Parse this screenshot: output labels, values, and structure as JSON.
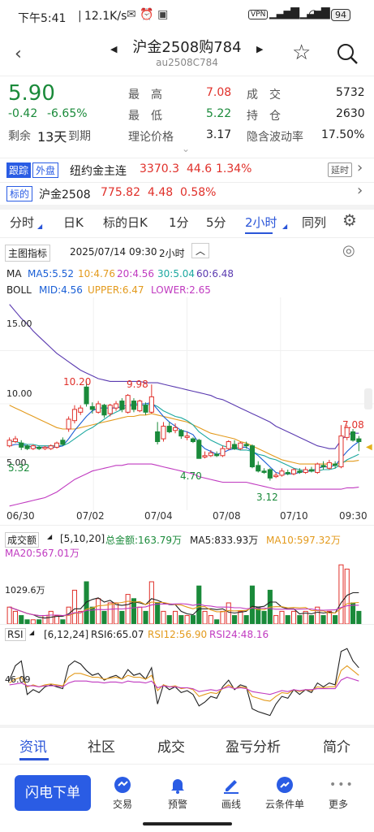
{
  "status_bar": {
    "time": "下午5:41",
    "speed": "12.1K/s",
    "battery": "94"
  },
  "header": {
    "title": "沪金2508购784",
    "code": "au2508C784"
  },
  "quote": {
    "price": "5.90",
    "change": "-0.42",
    "change_pct": "-6.65%",
    "remain_label": "剩余",
    "remain_days": "13天",
    "expire_label": "到期",
    "high_label": "最　高",
    "high": "7.08",
    "low_label": "最　低",
    "low": "5.22",
    "theory_label": "理论价格",
    "theory": "3.17",
    "volume_label": "成　交",
    "volume": "5732",
    "oi_label": "持　仓",
    "oi": "2630",
    "iv_label": "隐含波动率",
    "iv": "17.50%"
  },
  "track": {
    "tag1": "跟踪",
    "tag2": "外盘",
    "name": "纽约金主连",
    "price": "3370.3",
    "chg": "44.6",
    "pct": "1.34%",
    "delay": "延时"
  },
  "underlying": {
    "tag": "标的",
    "name": "沪金2508",
    "price": "775.82",
    "chg": "4.48",
    "pct": "0.58%"
  },
  "period_tabs": [
    "分时",
    "日K",
    "标的日K",
    "1分",
    "5分",
    "2小时",
    "同列"
  ],
  "chart_header": {
    "indicator": "主图指标",
    "datetime": "2025/07/14 09:30",
    "period": "2小时"
  },
  "ma_legend": {
    "ma": "MA",
    "ma5": "MA5:5.52",
    "ma10": "10:4.76",
    "ma20": "20:4.56",
    "ma30": "30:5.04",
    "ma60": "60:6.48"
  },
  "boll_legend": {
    "boll": "BOLL",
    "mid": "MID:4.56",
    "upper": "UPPER:6.47",
    "lower": "LOWER:2.65"
  },
  "price_axis": {
    "p15": "15.00",
    "p10": "10.00",
    "p5": "5.00"
  },
  "price_marks": {
    "m1": "10.20",
    "m2": "9.98",
    "m3": "4.70",
    "m4": "3.12",
    "m5": "7.08",
    "m6": "5.32"
  },
  "date_axis": [
    "06/30",
    "07/02",
    "07/04",
    "07/08",
    "07/10",
    "09:30"
  ],
  "vol_legend": {
    "name": "成交额",
    "params": "[5,10,20]",
    "total": "总金额:163.79万",
    "ma5": "MA5:833.93万",
    "ma10": "MA10:597.32万",
    "ma20": "MA20:567.01万",
    "axis": "1029.6万"
  },
  "rsi_legend": {
    "name": "RSI",
    "params": "[6,12,24]",
    "rsi6": "RSI6:65.07",
    "rsi12": "RSI12:56.90",
    "rsi24": "RSI24:48.16",
    "axis": "46.09"
  },
  "bottom_tabs": [
    "资讯",
    "社区",
    "成交",
    "盈亏分析",
    "简介"
  ],
  "bottom_nav": {
    "flash": "闪电下单",
    "items": [
      "交易",
      "预警",
      "画线",
      "云条件单",
      "更多"
    ]
  },
  "colors": {
    "up": "#e0302a",
    "down": "#1a8a3a",
    "accent": "#2a55d8"
  },
  "chart_data": {
    "type": "candlestick",
    "candles": [
      {
        "o": 5.6,
        "c": 6.0,
        "h": 6.2,
        "l": 5.5
      },
      {
        "o": 5.9,
        "c": 6.1,
        "h": 6.3,
        "l": 5.8
      },
      {
        "o": 5.8,
        "c": 5.5,
        "h": 6.0,
        "l": 5.3
      },
      {
        "o": 5.6,
        "c": 5.4,
        "h": 5.7,
        "l": 5.3
      },
      {
        "o": 5.4,
        "c": 5.6,
        "h": 5.7,
        "l": 5.3
      },
      {
        "o": 5.5,
        "c": 5.4,
        "h": 5.6,
        "l": 5.3
      },
      {
        "o": 5.4,
        "c": 5.5,
        "h": 5.6,
        "l": 5.3
      },
      {
        "o": 5.4,
        "c": 5.6,
        "h": 5.7,
        "l": 5.3
      },
      {
        "o": 5.5,
        "c": 5.8,
        "h": 5.9,
        "l": 5.4
      },
      {
        "o": 6.0,
        "c": 5.7,
        "h": 6.2,
        "l": 5.6
      },
      {
        "o": 6.8,
        "c": 7.5,
        "h": 7.7,
        "l": 6.6
      },
      {
        "o": 7.4,
        "c": 8.2,
        "h": 8.5,
        "l": 7.2
      },
      {
        "o": 8.0,
        "c": 8.3,
        "h": 8.5,
        "l": 7.8
      },
      {
        "o": 9.8,
        "c": 8.6,
        "h": 10.2,
        "l": 8.4
      },
      {
        "o": 8.4,
        "c": 8.2,
        "h": 8.7,
        "l": 7.9
      },
      {
        "o": 8.0,
        "c": 8.6,
        "h": 8.8,
        "l": 7.9
      },
      {
        "o": 8.5,
        "c": 7.8,
        "h": 8.6,
        "l": 7.6
      },
      {
        "o": 7.9,
        "c": 8.5,
        "h": 8.6,
        "l": 7.7
      },
      {
        "o": 8.3,
        "c": 8.6,
        "h": 8.8,
        "l": 8.1
      },
      {
        "o": 8.8,
        "c": 8.2,
        "h": 9.0,
        "l": 8.0
      },
      {
        "o": 8.0,
        "c": 9.2,
        "h": 9.3,
        "l": 7.9
      },
      {
        "o": 8.8,
        "c": 8.2,
        "h": 9.0,
        "l": 8.0
      },
      {
        "o": 8.1,
        "c": 8.8,
        "h": 8.9,
        "l": 8.0
      },
      {
        "o": 8.5,
        "c": 8.0,
        "h": 8.7,
        "l": 7.8
      },
      {
        "o": 8.0,
        "c": 9.1,
        "h": 9.98,
        "l": 7.9
      },
      {
        "o": 6.6,
        "c": 5.9,
        "h": 7.3,
        "l": 5.7
      },
      {
        "o": 6.1,
        "c": 7.0,
        "h": 7.3,
        "l": 5.9
      },
      {
        "o": 7.0,
        "c": 6.6,
        "h": 7.3,
        "l": 6.5
      },
      {
        "o": 6.7,
        "c": 6.9,
        "h": 7.2,
        "l": 6.5
      },
      {
        "o": 6.7,
        "c": 6.3,
        "h": 6.8,
        "l": 6.1
      },
      {
        "o": 6.2,
        "c": 6.3,
        "h": 6.6,
        "l": 6.0
      },
      {
        "o": 6.1,
        "c": 5.9,
        "h": 6.2,
        "l": 5.8
      },
      {
        "o": 6.0,
        "c": 4.7,
        "h": 6.1,
        "l": 4.7
      },
      {
        "o": 4.8,
        "c": 4.9,
        "h": 5.2,
        "l": 4.7
      },
      {
        "o": 4.9,
        "c": 5.1,
        "h": 5.3,
        "l": 4.8
      },
      {
        "o": 5.0,
        "c": 4.9,
        "h": 5.2,
        "l": 4.8
      },
      {
        "o": 4.9,
        "c": 5.4,
        "h": 5.6,
        "l": 4.8
      },
      {
        "o": 5.4,
        "c": 5.9,
        "h": 6.0,
        "l": 5.3
      },
      {
        "o": 5.7,
        "c": 5.4,
        "h": 6.0,
        "l": 5.3
      },
      {
        "o": 5.4,
        "c": 5.8,
        "h": 5.9,
        "l": 5.3
      },
      {
        "o": 5.7,
        "c": 5.6,
        "h": 5.9,
        "l": 5.4
      },
      {
        "o": 5.6,
        "c": 4.1,
        "h": 5.7,
        "l": 4.0
      },
      {
        "o": 4.2,
        "c": 3.8,
        "h": 4.5,
        "l": 3.7
      },
      {
        "o": 3.8,
        "c": 3.7,
        "h": 4.0,
        "l": 3.6
      },
      {
        "o": 3.9,
        "c": 3.3,
        "h": 4.0,
        "l": 3.12
      },
      {
        "o": 3.4,
        "c": 3.5,
        "h": 3.7,
        "l": 3.3
      },
      {
        "o": 3.5,
        "c": 3.8,
        "h": 4.0,
        "l": 3.4
      },
      {
        "o": 3.7,
        "c": 3.6,
        "h": 3.9,
        "l": 3.5
      },
      {
        "o": 3.6,
        "c": 3.9,
        "h": 4.0,
        "l": 3.5
      },
      {
        "o": 3.8,
        "c": 3.7,
        "h": 4.0,
        "l": 3.6
      },
      {
        "o": 3.7,
        "c": 3.9,
        "h": 4.1,
        "l": 3.6
      },
      {
        "o": 3.9,
        "c": 3.8,
        "h": 4.1,
        "l": 3.7
      },
      {
        "o": 3.7,
        "c": 4.3,
        "h": 4.4,
        "l": 3.6
      },
      {
        "o": 4.2,
        "c": 4.1,
        "h": 4.5,
        "l": 3.9
      },
      {
        "o": 4.0,
        "c": 4.4,
        "h": 4.6,
        "l": 3.9
      },
      {
        "o": 4.3,
        "c": 4.2,
        "h": 4.5,
        "l": 4.0
      },
      {
        "o": 4.1,
        "c": 6.3,
        "h": 7.08,
        "l": 4.0
      },
      {
        "o": 6.2,
        "c": 6.9,
        "h": 7.08,
        "l": 6.0
      },
      {
        "o": 6.6,
        "c": 6.0,
        "h": 6.8,
        "l": 5.9
      },
      {
        "o": 6.1,
        "c": 5.9,
        "h": 6.3,
        "l": 5.22
      }
    ],
    "ma5": [
      5.6,
      5.7,
      5.7,
      5.6,
      5.5,
      5.5,
      5.5,
      5.5,
      5.5,
      5.6,
      6.1,
      6.7,
      7.2,
      7.7,
      8.1,
      8.3,
      8.3,
      8.3,
      8.3,
      8.4,
      8.5,
      8.6,
      8.6,
      8.6,
      8.7,
      8.2,
      7.7,
      7.3,
      7.0,
      6.7,
      6.6,
      6.4,
      5.8,
      5.4,
      5.2,
      5.0,
      5.1,
      5.3,
      5.4,
      5.5,
      5.5,
      5.2,
      4.9,
      4.5,
      4.1,
      3.7,
      3.6,
      3.6,
      3.6,
      3.7,
      3.8,
      3.8,
      4.0,
      4.1,
      4.1,
      4.2,
      4.7,
      5.2,
      5.6,
      5.9
    ],
    "ma10": [
      5.9,
      5.9,
      5.8,
      5.7,
      5.7,
      5.6,
      5.6,
      5.6,
      5.6,
      5.6,
      5.8,
      6.1,
      6.4,
      6.7,
      6.9,
      7.2,
      7.5,
      7.8,
      8.0,
      8.2,
      8.4,
      8.5,
      8.5,
      8.5,
      8.6,
      8.4,
      8.1,
      7.9,
      7.7,
      7.6,
      7.4,
      7.1,
      6.6,
      6.3,
      6.0,
      5.8,
      5.6,
      5.5,
      5.4,
      5.3,
      5.3,
      5.2,
      5.0,
      4.9,
      4.7,
      4.6,
      4.4,
      4.2,
      4.0,
      3.9,
      3.8,
      3.8,
      3.8,
      3.9,
      3.9,
      4.0,
      4.3,
      4.6,
      4.8,
      5.0
    ],
    "boll_upper": [
      15.7,
      15.2,
      14.7,
      14.3,
      13.8,
      13.4,
      13.0,
      12.6,
      12.2,
      11.9,
      11.6,
      11.3,
      11.0,
      10.8,
      10.6,
      10.4,
      10.3,
      10.2,
      10.2,
      10.2,
      10.2,
      10.2,
      10.2,
      10.1,
      10.1,
      10.1,
      10.0,
      9.9,
      9.8,
      9.7,
      9.6,
      9.5,
      9.4,
      9.3,
      9.2,
      9.0,
      8.9,
      8.7,
      8.5,
      8.3,
      8.1,
      7.9,
      7.7,
      7.5,
      7.3,
      7.0,
      6.8,
      6.6,
      6.4,
      6.2,
      6.0,
      5.8,
      5.6,
      5.5,
      5.4,
      5.4,
      6.0,
      6.4,
      6.5,
      6.5
    ],
    "boll_mid": [
      8.5,
      8.3,
      8.1,
      7.9,
      7.7,
      7.5,
      7.3,
      7.1,
      6.9,
      6.8,
      6.8,
      6.8,
      6.9,
      7.0,
      7.1,
      7.2,
      7.3,
      7.4,
      7.5,
      7.6,
      7.7,
      7.7,
      7.8,
      7.8,
      7.9,
      7.8,
      7.7,
      7.6,
      7.5,
      7.4,
      7.3,
      7.1,
      6.9,
      6.7,
      6.5,
      6.4,
      6.3,
      6.2,
      6.1,
      5.9,
      5.8,
      5.6,
      5.4,
      5.2,
      5.0,
      4.8,
      4.6,
      4.5,
      4.4,
      4.3,
      4.3,
      4.3,
      4.3,
      4.3,
      4.3,
      4.3,
      4.4,
      4.5,
      4.5,
      4.56
    ],
    "boll_lower": [
      1.3,
      1.4,
      1.5,
      1.6,
      1.7,
      1.8,
      1.9,
      2.1,
      2.3,
      2.6,
      2.9,
      3.2,
      3.4,
      3.6,
      3.8,
      3.9,
      4.0,
      4.1,
      4.2,
      4.2,
      4.3,
      4.3,
      4.3,
      4.3,
      4.3,
      4.2,
      4.1,
      4.0,
      3.9,
      3.8,
      3.7,
      3.6,
      3.4,
      3.3,
      3.2,
      3.1,
      3.0,
      3.0,
      3.0,
      3.0,
      3.0,
      2.9,
      2.8,
      2.7,
      2.6,
      2.5,
      2.5,
      2.5,
      2.5,
      2.5,
      2.5,
      2.5,
      2.5,
      2.5,
      2.5,
      2.5,
      2.5,
      2.6,
      2.6,
      2.65
    ],
    "volume": [
      4,
      3,
      2,
      1,
      1,
      1,
      2,
      3,
      2,
      1,
      4,
      8,
      3,
      10,
      4,
      6,
      3,
      5,
      5,
      3,
      7,
      6,
      4,
      3,
      10,
      5,
      3,
      2,
      3,
      2,
      2,
      2,
      9,
      3,
      2,
      1,
      3,
      5,
      2,
      3,
      2,
      9,
      4,
      3,
      8,
      2,
      3,
      2,
      3,
      2,
      3,
      2,
      4,
      2,
      3,
      2,
      14,
      13,
      5,
      3
    ],
    "rsi6": [
      55,
      70,
      75,
      40,
      45,
      42,
      48,
      50,
      48,
      46,
      70,
      75,
      72,
      65,
      60,
      62,
      55,
      58,
      60,
      56,
      66,
      60,
      62,
      56,
      68,
      30,
      50,
      45,
      48,
      42,
      44,
      40,
      28,
      32,
      38,
      36,
      48,
      55,
      45,
      50,
      48,
      25,
      22,
      20,
      18,
      30,
      38,
      36,
      45,
      40,
      45,
      42,
      52,
      48,
      52,
      50,
      85,
      88,
      75,
      68
    ],
    "rsi12": [
      52,
      56,
      58,
      48,
      50,
      48,
      50,
      51,
      50,
      49,
      58,
      62,
      62,
      60,
      58,
      58,
      56,
      57,
      58,
      56,
      60,
      58,
      58,
      56,
      60,
      44,
      50,
      48,
      49,
      46,
      47,
      45,
      38,
      40,
      42,
      41,
      46,
      50,
      46,
      48,
      47,
      38,
      36,
      34,
      33,
      38,
      42,
      41,
      45,
      43,
      45,
      44,
      48,
      47,
      48,
      48,
      65,
      70,
      65,
      60
    ],
    "rsi24": [
      50,
      51,
      52,
      49,
      49,
      48,
      49,
      49,
      49,
      48,
      52,
      54,
      54,
      54,
      53,
      53,
      52,
      53,
      53,
      52,
      54,
      53,
      53,
      52,
      54,
      47,
      49,
      48,
      48,
      47,
      47,
      46,
      43,
      44,
      45,
      44,
      46,
      48,
      46,
      47,
      46,
      43,
      42,
      41,
      40,
      42,
      44,
      43,
      45,
      44,
      45,
      45,
      46,
      46,
      46,
      46,
      55,
      58,
      56,
      54
    ]
  }
}
